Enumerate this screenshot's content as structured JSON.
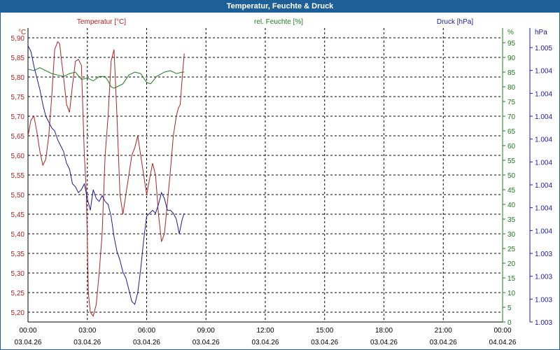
{
  "window": {
    "title": "Temperatur, Feuchte & Druck"
  },
  "chart_data": {
    "type": "line",
    "x_ticks": [
      {
        "time": "00:00",
        "date": "03.04.26"
      },
      {
        "time": "03:00",
        "date": "03.04.26"
      },
      {
        "time": "06:00",
        "date": "03.04.26"
      },
      {
        "time": "09:00",
        "date": "03.04.26"
      },
      {
        "time": "12:00",
        "date": "03.04.26"
      },
      {
        "time": "15:00",
        "date": "03.04.26"
      },
      {
        "time": "18:00",
        "date": "03.04.26"
      },
      {
        "time": "21:00",
        "date": "03.04.26"
      },
      {
        "time": "00:00",
        "date": "04.04.26"
      }
    ],
    "xlim_hours": [
      0,
      24
    ],
    "axes": {
      "temperature": {
        "label": "Temperatur [°C]",
        "unit": "°C",
        "color": "#b22222",
        "ylim": [
          5.175,
          5.925
        ],
        "ticks": [
          "5,90",
          "5,85",
          "5,80",
          "5,75",
          "5,70",
          "5,65",
          "5,60",
          "5,55",
          "5,50",
          "5,45",
          "5,40",
          "5,35",
          "5,30",
          "5,25",
          "5,20"
        ]
      },
      "humidity": {
        "label": "rel. Feuchte [%]",
        "unit": "%",
        "color": "#1e7b1e",
        "ylim": [
          0,
          100
        ],
        "ticks": [
          "95",
          "90",
          "85",
          "80",
          "75",
          "70",
          "65",
          "60",
          "55",
          "50",
          "45",
          "40",
          "35",
          "30",
          "25",
          "20",
          "15",
          "10",
          "5",
          "0"
        ]
      },
      "pressure": {
        "label": "Druck [hPa]",
        "unit": "hPa",
        "color": "#1a1aa0",
        "ylim": [
          0,
          1
        ],
        "ticks": [
          "1.005",
          "1.004",
          "1.004",
          "1.004",
          "1.004",
          "1.004",
          "1.004",
          "1.004",
          "1.004",
          "1.003",
          "1.003",
          "1.003",
          "1.003"
        ]
      }
    },
    "grid": true,
    "series": [
      {
        "name": "Temperatur [°C]",
        "axis": "temperature",
        "color": "#b22222",
        "points": [
          [
            0,
            5.65
          ],
          [
            0.15,
            5.69
          ],
          [
            0.3,
            5.7
          ],
          [
            0.45,
            5.66
          ],
          [
            0.6,
            5.61
          ],
          [
            0.75,
            5.575
          ],
          [
            0.9,
            5.59
          ],
          [
            1.05,
            5.65
          ],
          [
            1.2,
            5.75
          ],
          [
            1.35,
            5.87
          ],
          [
            1.5,
            5.89
          ],
          [
            1.6,
            5.885
          ],
          [
            1.7,
            5.84
          ],
          [
            1.8,
            5.8
          ],
          [
            1.95,
            5.73
          ],
          [
            2.1,
            5.71
          ],
          [
            2.25,
            5.78
          ],
          [
            2.4,
            5.84
          ],
          [
            2.55,
            5.845
          ],
          [
            2.7,
            5.83
          ],
          [
            2.85,
            5.6
          ],
          [
            2.95,
            5.51
          ],
          [
            3.05,
            5.25
          ],
          [
            3.15,
            5.2
          ],
          [
            3.3,
            5.19
          ],
          [
            3.45,
            5.22
          ],
          [
            3.6,
            5.3
          ],
          [
            3.75,
            5.4
          ],
          [
            3.9,
            5.6
          ],
          [
            4.05,
            5.7
          ],
          [
            4.2,
            5.84
          ],
          [
            4.35,
            5.87
          ],
          [
            4.5,
            5.7
          ],
          [
            4.65,
            5.5
          ],
          [
            4.8,
            5.45
          ],
          [
            4.95,
            5.5
          ],
          [
            5.1,
            5.55
          ],
          [
            5.25,
            5.6
          ],
          [
            5.4,
            5.62
          ],
          [
            5.55,
            5.65
          ],
          [
            5.7,
            5.6
          ],
          [
            5.85,
            5.55
          ],
          [
            6.0,
            5.5
          ],
          [
            6.15,
            5.54
          ],
          [
            6.3,
            5.58
          ],
          [
            6.45,
            5.55
          ],
          [
            6.6,
            5.45
          ],
          [
            6.75,
            5.38
          ],
          [
            6.9,
            5.4
          ],
          [
            7.05,
            5.48
          ],
          [
            7.2,
            5.56
          ],
          [
            7.35,
            5.65
          ],
          [
            7.5,
            5.7
          ],
          [
            7.6,
            5.72
          ],
          [
            7.7,
            5.73
          ],
          [
            7.8,
            5.8
          ],
          [
            7.9,
            5.86
          ]
        ]
      },
      {
        "name": "rel. Feuchte [%]",
        "axis": "humidity",
        "color": "#1e7b1e",
        "points": [
          [
            0,
            86
          ],
          [
            0.3,
            85.5
          ],
          [
            0.6,
            86.5
          ],
          [
            0.9,
            85.5
          ],
          [
            1.2,
            84.5
          ],
          [
            1.5,
            84
          ],
          [
            1.8,
            83.5
          ],
          [
            2.1,
            84.5
          ],
          [
            2.4,
            85
          ],
          [
            2.7,
            82.5
          ],
          [
            3.0,
            83
          ],
          [
            3.3,
            82
          ],
          [
            3.6,
            83.5
          ],
          [
            3.9,
            83.5
          ],
          [
            4.05,
            82
          ],
          [
            4.2,
            80
          ],
          [
            4.35,
            79.5
          ],
          [
            4.5,
            80
          ],
          [
            4.8,
            81
          ],
          [
            5.1,
            84
          ],
          [
            5.4,
            85
          ],
          [
            5.7,
            84.5
          ],
          [
            6.0,
            81.5
          ],
          [
            6.2,
            81
          ],
          [
            6.5,
            83.5
          ],
          [
            6.9,
            85
          ],
          [
            7.2,
            85.5
          ],
          [
            7.5,
            84.5
          ],
          [
            7.8,
            85
          ],
          [
            7.9,
            85
          ]
        ]
      },
      {
        "name": "Druck [hPa]",
        "axis": "pressure",
        "color": "#1a1aa0",
        "points": [
          [
            0,
            0.94
          ],
          [
            0.15,
            0.92
          ],
          [
            0.3,
            0.87
          ],
          [
            0.45,
            0.83
          ],
          [
            0.6,
            0.79
          ],
          [
            0.75,
            0.74
          ],
          [
            0.9,
            0.7
          ],
          [
            1.05,
            0.68
          ],
          [
            1.2,
            0.66
          ],
          [
            1.35,
            0.65
          ],
          [
            1.5,
            0.62
          ],
          [
            1.65,
            0.6
          ],
          [
            1.8,
            0.58
          ],
          [
            1.95,
            0.54
          ],
          [
            2.1,
            0.52
          ],
          [
            2.25,
            0.47
          ],
          [
            2.4,
            0.46
          ],
          [
            2.55,
            0.44
          ],
          [
            2.7,
            0.45
          ],
          [
            2.85,
            0.47
          ],
          [
            3.0,
            0.42
          ],
          [
            3.15,
            0.38
          ],
          [
            3.3,
            0.45
          ],
          [
            3.45,
            0.42
          ],
          [
            3.6,
            0.41
          ],
          [
            3.75,
            0.43
          ],
          [
            3.9,
            0.41
          ],
          [
            4.05,
            0.4
          ],
          [
            4.2,
            0.36
          ],
          [
            4.35,
            0.29
          ],
          [
            4.5,
            0.24
          ],
          [
            4.65,
            0.21
          ],
          [
            4.8,
            0.17
          ],
          [
            4.95,
            0.15
          ],
          [
            5.1,
            0.11
          ],
          [
            5.25,
            0.07
          ],
          [
            5.4,
            0.06
          ],
          [
            5.55,
            0.1
          ],
          [
            5.7,
            0.18
          ],
          [
            5.85,
            0.28
          ],
          [
            6.0,
            0.36
          ],
          [
            6.15,
            0.37
          ],
          [
            6.3,
            0.38
          ],
          [
            6.45,
            0.37
          ],
          [
            6.6,
            0.4
          ],
          [
            6.75,
            0.44
          ],
          [
            6.9,
            0.42
          ],
          [
            7.05,
            0.38
          ],
          [
            7.2,
            0.38
          ],
          [
            7.35,
            0.37
          ],
          [
            7.5,
            0.35
          ],
          [
            7.65,
            0.3
          ],
          [
            7.8,
            0.35
          ],
          [
            7.9,
            0.37
          ]
        ]
      }
    ]
  }
}
